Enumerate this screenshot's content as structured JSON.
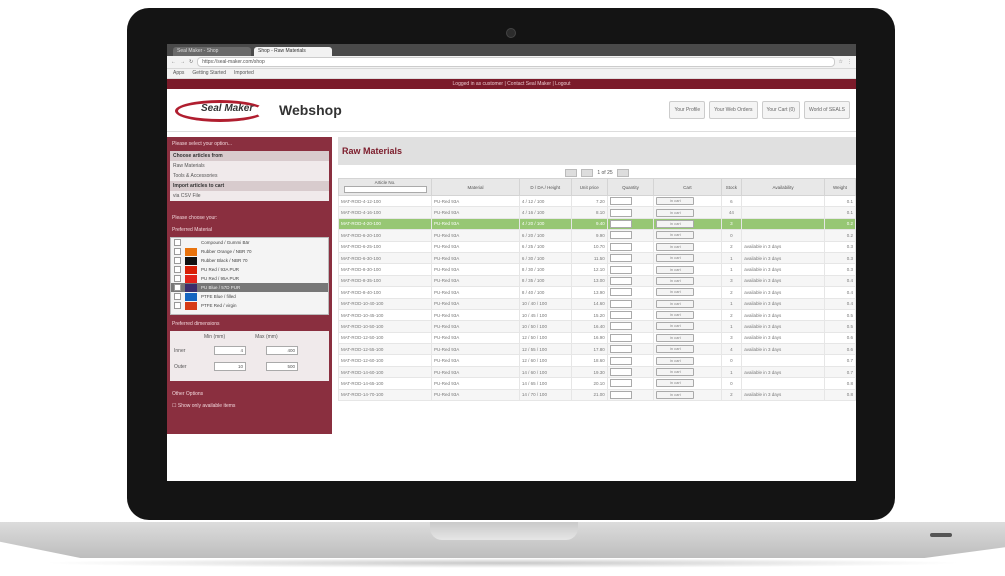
{
  "browser": {
    "tabs": [
      {
        "label": "Seal Maker - Shop"
      },
      {
        "label": "Shop - Raw Materials"
      }
    ],
    "url": "https://seal-maker.com/shop",
    "bookmarks": [
      {
        "label": "Apps"
      },
      {
        "label": "Getting Started"
      },
      {
        "label": "Imported"
      }
    ]
  },
  "site": {
    "top_notice": "Logged in as customer | Contact Seal Maker | Logout",
    "logo_text": "Seal Maker",
    "title": "Webshop",
    "header_buttons": [
      {
        "label": "Your Profile"
      },
      {
        "label": "Your Web Orders"
      },
      {
        "label": "Your Cart (0)"
      },
      {
        "label": "World of SEALS"
      }
    ]
  },
  "sidebar": {
    "options_header": "Please select your option...",
    "choose_title": "Choose articles from",
    "choose_links": [
      "Raw Materials",
      "Tools & Accessories"
    ],
    "import_title": "Import articles to cart",
    "import_links": [
      "via CSV File"
    ],
    "choose_header": "Please choose your:",
    "preferred_material": "Preferred Material",
    "materials": [
      {
        "name": "Compound / Gummi Bär",
        "color": "#f4f4f4"
      },
      {
        "name": "Rubber Orange / NBR 70",
        "color": "#e8720c"
      },
      {
        "name": "Rubber Black / NBR 70",
        "color": "#111111"
      },
      {
        "name": "PU Red / 93A PUR",
        "color": "#d81e05"
      },
      {
        "name": "PU Red / 95A PUR",
        "color": "#e2231a"
      },
      {
        "name": "PU Blue / 57D PUR",
        "color": "#3b2d6b"
      },
      {
        "name": "PTFE Blue / filled",
        "color": "#1565c0"
      },
      {
        "name": "PTFE Red / virgin",
        "color": "#d63b16"
      }
    ],
    "dimensions_header": "Preferred dimensions",
    "dim_from": "Min (mm)",
    "dim_to": "Max (mm)",
    "dim_rows": [
      {
        "label": "Inner",
        "min": "4",
        "max": "400"
      },
      {
        "label": "Outer",
        "min": "10",
        "max": "500"
      }
    ],
    "other_header": "Other Options",
    "other_option": "Show only available items"
  },
  "main": {
    "title": "Raw Materials",
    "pager": "1 of 25",
    "columns": [
      "Article No.",
      "Material",
      "D / DA / Height",
      "Unit price",
      "Quantity",
      "Cart",
      "Stock",
      "Availability",
      "Weight"
    ],
    "rows": [
      {
        "art": "MAT-ROD-4-12-100",
        "mat": "PU-Red 93A",
        "dim": "4 / 12 / 100",
        "price": "7.20",
        "stock": "6",
        "avail": "",
        "wt": "0.1"
      },
      {
        "art": "MAT-ROD-4-16-100",
        "mat": "PU-Red 93A",
        "dim": "4 / 16 / 100",
        "price": "8.10",
        "stock": "44",
        "avail": "",
        "wt": "0.1"
      },
      {
        "art": "MAT-ROD-4-20-100",
        "mat": "PU-Red 93A",
        "dim": "4 / 20 / 100",
        "price": "9.40",
        "stock": "3",
        "avail": "",
        "wt": "0.2"
      },
      {
        "art": "MAT-ROD-6-20-100",
        "mat": "PU-Red 93A",
        "dim": "6 / 20 / 100",
        "price": "9.90",
        "stock": "0",
        "avail": "",
        "wt": "0.2"
      },
      {
        "art": "MAT-ROD-6-25-100",
        "mat": "PU-Red 93A",
        "dim": "6 / 25 / 100",
        "price": "10.70",
        "stock": "2",
        "avail": "available in 3 days",
        "wt": "0.3"
      },
      {
        "art": "MAT-ROD-6-30-100",
        "mat": "PU-Red 93A",
        "dim": "6 / 30 / 100",
        "price": "11.50",
        "stock": "1",
        "avail": "available in 3 days",
        "wt": "0.3"
      },
      {
        "art": "MAT-ROD-8-30-100",
        "mat": "PU-Red 93A",
        "dim": "8 / 30 / 100",
        "price": "12.10",
        "stock": "1",
        "avail": "available in 3 days",
        "wt": "0.3"
      },
      {
        "art": "MAT-ROD-8-35-100",
        "mat": "PU-Red 93A",
        "dim": "8 / 35 / 100",
        "price": "13.00",
        "stock": "3",
        "avail": "available in 3 days",
        "wt": "0.4"
      },
      {
        "art": "MAT-ROD-8-40-100",
        "mat": "PU-Red 93A",
        "dim": "8 / 40 / 100",
        "price": "13.90",
        "stock": "2",
        "avail": "available in 3 days",
        "wt": "0.4"
      },
      {
        "art": "MAT-ROD-10-40-100",
        "mat": "PU-Red 93A",
        "dim": "10 / 40 / 100",
        "price": "14.60",
        "stock": "1",
        "avail": "available in 3 days",
        "wt": "0.4"
      },
      {
        "art": "MAT-ROD-10-45-100",
        "mat": "PU-Red 93A",
        "dim": "10 / 45 / 100",
        "price": "15.20",
        "stock": "2",
        "avail": "available in 3 days",
        "wt": "0.5"
      },
      {
        "art": "MAT-ROD-10-50-100",
        "mat": "PU-Red 93A",
        "dim": "10 / 50 / 100",
        "price": "16.40",
        "stock": "1",
        "avail": "available in 3 days",
        "wt": "0.5"
      },
      {
        "art": "MAT-ROD-12-50-100",
        "mat": "PU-Red 93A",
        "dim": "12 / 50 / 100",
        "price": "16.90",
        "stock": "3",
        "avail": "available in 3 days",
        "wt": "0.6"
      },
      {
        "art": "MAT-ROD-12-55-100",
        "mat": "PU-Red 93A",
        "dim": "12 / 55 / 100",
        "price": "17.80",
        "stock": "4",
        "avail": "available in 3 days",
        "wt": "0.6"
      },
      {
        "art": "MAT-ROD-12-60-100",
        "mat": "PU-Red 93A",
        "dim": "12 / 60 / 100",
        "price": "18.60",
        "stock": "0",
        "avail": "",
        "wt": "0.7"
      },
      {
        "art": "MAT-ROD-14-60-100",
        "mat": "PU-Red 93A",
        "dim": "14 / 60 / 100",
        "price": "19.30",
        "stock": "1",
        "avail": "available in 3 days",
        "wt": "0.7"
      },
      {
        "art": "MAT-ROD-14-65-100",
        "mat": "PU-Red 93A",
        "dim": "14 / 65 / 100",
        "price": "20.10",
        "stock": "0",
        "avail": "",
        "wt": "0.8"
      },
      {
        "art": "MAT-ROD-14-70-100",
        "mat": "PU-Red 93A",
        "dim": "14 / 70 / 100",
        "price": "21.00",
        "stock": "2",
        "avail": "available in 3 days",
        "wt": "0.8"
      }
    ],
    "highlighted_row": 2,
    "add_label": "in cart",
    "colors": {
      "accent": "#7b1b2a",
      "highlight": "#97c774",
      "sidebar": "#8a2f3f"
    }
  }
}
